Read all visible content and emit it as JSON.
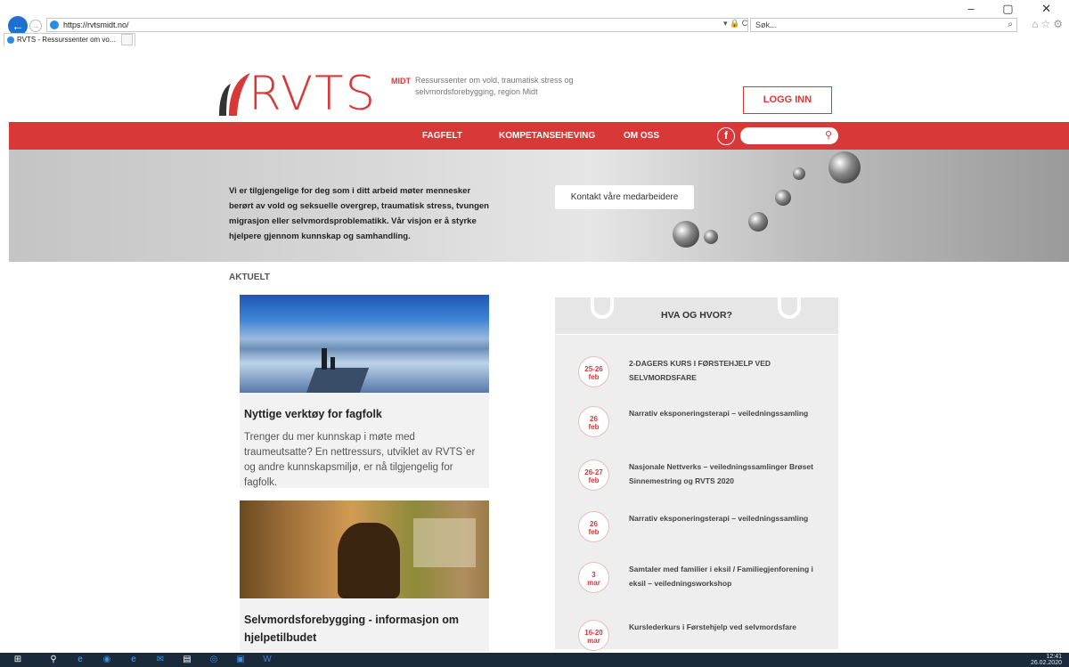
{
  "browser": {
    "url": "https://rvtsmidt.no/",
    "search_placeholder": "Søk...",
    "tab_title": "RVTS - Ressurssenter om vo...",
    "tab_close": "×",
    "window_controls": "–  ▢  ✕",
    "url_tools": "▾ 🔒 C"
  },
  "header": {
    "logo_text": "RVTS",
    "logo_sub": "MIDT",
    "tagline": "Ressurssenter om vold, traumatisk stress og selvmordsforebygging, region Midt",
    "login_label": "LOGG INN"
  },
  "nav": {
    "items": [
      {
        "label": "FAGFELT"
      },
      {
        "label": "KOMPETANSEHEVING"
      },
      {
        "label": "OM OSS"
      }
    ],
    "facebook": "f"
  },
  "hero": {
    "text": "Vi er tilgjengelige for deg som i ditt arbeid møter mennesker berørt av vold og seksuelle overgrep, traumatisk stress, tvungen migrasjon eller selvmordsproblematikk. Vår visjon er å styrke hjelpere gjennom kunnskap og samhandling.",
    "contact_label": "Kontakt våre medarbeidere"
  },
  "aktuelt": {
    "heading": "AKTUELT",
    "cards": [
      {
        "title": "Nyttige verktøy for fagfolk",
        "text": "Trenger du mer kunnskap i møte med traumeutsatte? En nettressurs, utviklet av RVTS`er og andre kunnskapsmiljø, er nå tilgjengelig for fagfolk."
      },
      {
        "title": "Selvmordsforebygging - informasjon om hjelpetilbudet",
        "text": ""
      }
    ]
  },
  "hva": {
    "title": "HVA OG HVOR?",
    "events": [
      {
        "day": "25-26",
        "month": "feb",
        "title": "2-DAGERS KURS I FØRSTEHJELP VED SELVMORDSFARE"
      },
      {
        "day": "26",
        "month": "feb",
        "title": "Narrativ eksponeringsterapi – veiledningssamling"
      },
      {
        "day": "26-27",
        "month": "feb",
        "title": "Nasjonale Nettverks – veiledningssamlinger Brøset Sinnemestring og RVTS 2020"
      },
      {
        "day": "26",
        "month": "feb",
        "title": "Narrativ eksponeringsterapi – veiledningssamling"
      },
      {
        "day": "3",
        "month": "mar",
        "title": "Samtaler med familier i eksil / Familiegjenforening i eksil – veiledningsworkshop"
      },
      {
        "day": "16-20",
        "month": "mar",
        "title": "Kurslederkurs i Førstehjelp ved selvmordsfare"
      }
    ]
  },
  "taskbar": {
    "time": "12:41",
    "date": "26.02.2020"
  }
}
